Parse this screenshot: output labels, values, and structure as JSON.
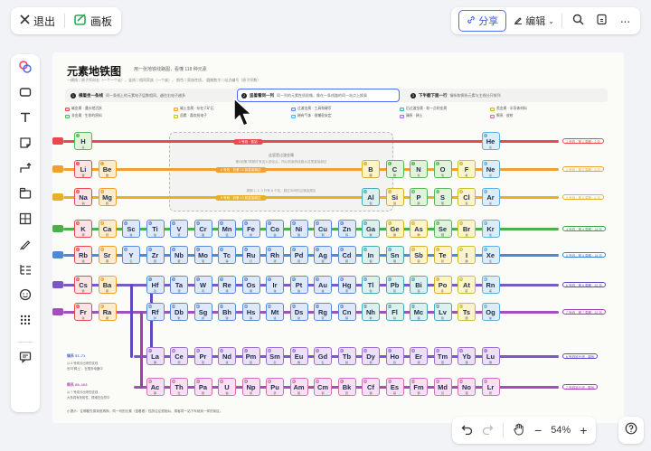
{
  "topbar": {
    "exit_label": "退出",
    "board_label": "画板",
    "share_label": "分享",
    "edit_label": "编辑"
  },
  "doc": {
    "title": "元素地铁图",
    "subtitle": "用一张地铁线路图，看懂 118 种元素",
    "info_line": "一横线＝原子序向右（一个一个走），竖线＝相同家族（一个族），  颜色＝家族性质，  圆圈数字＝站点编号（原子序数）",
    "steps": [
      {
        "num": "1",
        "title": "横着坐一条线",
        "desc": "同一条线上的元素电子层数相同，越往右电子越多"
      },
      {
        "num": "2",
        "title": "竖着看同一列",
        "desc": "同一列的元素性质很像，像在一条线路的同一站点上换乘"
      },
      {
        "num": "3",
        "title": "下半截下面一行",
        "desc": "镧系和锕系元素与主线分开排列"
      }
    ],
    "legend": [
      {
        "label": "碱金属 · 遇水就活跃",
        "color": "#e8484e"
      },
      {
        "label": "碱土金属 · 存在于矿石",
        "color": "#f0a030"
      },
      {
        "label": "过渡金属 · 工具和硬币",
        "color": "#5b8bd8"
      },
      {
        "label": "后过渡金属 · 软一点的金属",
        "color": "#4aa8b8"
      },
      {
        "label": "类金属 · 半导体材料",
        "color": "#d8b030"
      },
      {
        "label": "非金属 · 生命的原料",
        "color": "#58b858"
      },
      {
        "label": "卤素 · 喜欢抢电子",
        "color": "#c8c030"
      },
      {
        "label": "稀有气体 · 很懒很安定",
        "color": "#5ab0e0"
      },
      {
        "label": "镧系 · 稀土",
        "color": "#a070d0"
      },
      {
        "label": "锕系 · 放射",
        "color": "#d070b8"
      }
    ],
    "dash_texts": [
      "这里是过渡金属",
      "第4到第7周期才有这么多站点，所以前面的线路从这里直接越过",
      "周期 1, 2, 3 只有 8 个站，跳过中间的过渡金属区"
    ],
    "rail_labels": {
      "r1": "1 号线 · 氢站",
      "r2": "2 号线 · 到第 13 族直接跳过",
      "r3": "3 号线 · 到第 13 族直接跳过"
    },
    "side_labels": [
      "1 号线 · 第 1 周期 · 2 站",
      "2 号线 · 第 2 周期 · 8 站",
      "3 号线 · 第 3 周期 · 8 站",
      "4 号线 · 第 4 周期 · 18 站",
      "5 号线 · 第 5 周期 · 18 站",
      "6 号线 · 第 6 周期 · 32 站",
      "7 号线 · 第 7 周期 · 32 站",
      "6 号线延长线 · 镧系",
      "7 号线延长线 · 锕系"
    ],
    "notes": {
      "la_title": "镧系 57–71",
      "la_desc": "从 6 号线分出来的支线",
      "la_desc2": "也叫\"稀土\"，在很多电器中",
      "ac_title": "锕系 89–103",
      "ac_desc": "从 7 号线分出来的支线",
      "ac_desc2": "大多具有放射性，很难在自然中",
      "footer": "小提示：往哪都先乘到底再换，同一列的元素（竖着看）性质往往很相似，乘客同一站下车就到一样的街区。"
    }
  },
  "zoom": {
    "level": "54%"
  }
}
